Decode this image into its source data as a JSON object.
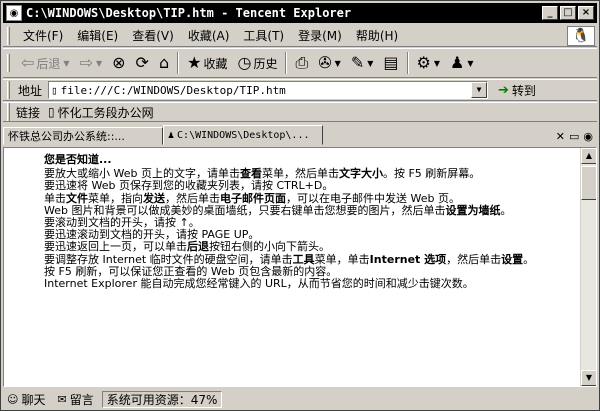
{
  "window": {
    "title": "C:\\WINDOWS\\Desktop\\TIP.htm - Tencent Explorer"
  },
  "menu": [
    "文件(F)",
    "编辑(E)",
    "查看(V)",
    "收藏(A)",
    "工具(T)",
    "登录(M)",
    "帮助(H)"
  ],
  "toolbar": {
    "back": "后退",
    "favorites": "收藏",
    "history": "历史"
  },
  "address": {
    "label": "地址",
    "url": "file:///C:/WINDOWS/Desktop/TIP.htm",
    "go": "转到"
  },
  "links": {
    "label": "链接",
    "item": "怀化工务段办公网"
  },
  "tabs": [
    {
      "label": "怀铁总公司办公系统::..."
    },
    {
      "label": "C:\\WINDOWS\\Desktop\\..."
    }
  ],
  "doc": {
    "heading": "您是否知道...",
    "l1a": "要放大或缩小 Web 页上的文字，请单击",
    "l1b": "查看",
    "l1c": "菜单，然后单击",
    "l1d": "文字大小",
    "l1e": "。按 F5 刷新屏幕。",
    "l2": "要迅速将 Web 页保存到您的收藏夹列表，请按 CTRL+D。",
    "l3a": "单击",
    "l3b": "文件",
    "l3c": "菜单，指向",
    "l3d": "发送",
    "l3e": "，然后单击",
    "l3f": "电子邮件页面",
    "l3g": "，可以在电子邮件中发送 Web 页。",
    "l4a": "Web 图片和背景可以做成美妙的桌面墙纸，只要右键单击您想要的图片，然后单击",
    "l4b": "设置为墙纸",
    "l4c": "。",
    "l5": "要滚动到文档的开头，请按 ↑。",
    "l6": "要迅速滚动到文档的开头，请按 PAGE UP。",
    "l7a": "要迅速返回上一页，可以单击",
    "l7b": "后退",
    "l7c": "按钮右侧的小向下箭头。",
    "l8a": "要调整存放 Internet 临时文件的硬盘空间，请单击",
    "l8b": "工具",
    "l8c": "菜单，单击",
    "l8d": "Internet 选项",
    "l8e": "，然后单击",
    "l8f": "设置",
    "l8g": "。",
    "l9": "按 F5 刷新，可以保证您正查看的 Web 页包含最新的内容。",
    "l10": "Internet Explorer 能自动完成您经常键入的 URL，从而节省您的时间和减少击键次数。"
  },
  "status": {
    "chat": "聊天",
    "message": "留言",
    "resources": "系统可用资源：47%"
  }
}
